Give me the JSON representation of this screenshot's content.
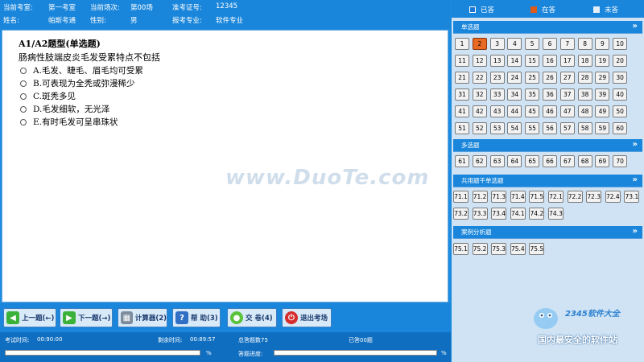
{
  "header": {
    "room_label": "当前考室:",
    "room_value": "第一考室",
    "session_label": "当前场次:",
    "session_value": "第00场",
    "ticket_label": "准考证号:",
    "ticket_value": "12345",
    "name_label": "姓名:",
    "name_value": "帕斯考通",
    "gender_label": "性别:",
    "gender_value": "男",
    "major_label": "报考专业:",
    "major_value": "软件专业"
  },
  "question": {
    "type_title": "A1/A2题型(单选题)",
    "stem": "肠病性肢端皮炎毛发受累特点不包括",
    "options": [
      "A.毛发、睫毛、眉毛均可受累",
      "B.可表现为全秃或弥漫稀少",
      "C.斑秃多见",
      "D.毛发细软，无光泽",
      "E.有时毛发可呈串珠状"
    ]
  },
  "toolbar": {
    "prev": "上一题(←)",
    "next": "下一题(→)",
    "calc": "计算器(2)",
    "help": "帮 助(3)",
    "submit": "交 卷(4)",
    "exit": "退出考场"
  },
  "footer": {
    "exam_time_label": "考试时间:",
    "exam_time_value": "00:90:00",
    "remaining_label": "剩余时间:",
    "remaining_value": "00:89:57",
    "total_label": "总答题数75",
    "answered_label": "已答00题",
    "progress_label": "答题进度:",
    "percent_sign": "%",
    "time_progress": 0,
    "answer_progress": 0
  },
  "legend": {
    "answered": "已答",
    "current": "在答",
    "unanswered": "未答"
  },
  "colors": {
    "answered": "#1e78d2",
    "current": "#e05a1a",
    "unanswered": "#e4eef8"
  },
  "sections": [
    {
      "title": "单选题",
      "current": "2",
      "items": [
        "1",
        "2",
        "3",
        "4",
        "5",
        "6",
        "7",
        "8",
        "9",
        "10",
        "11",
        "12",
        "13",
        "14",
        "15",
        "16",
        "17",
        "18",
        "19",
        "20",
        "21",
        "22",
        "23",
        "24",
        "25",
        "26",
        "27",
        "28",
        "29",
        "30",
        "31",
        "32",
        "33",
        "34",
        "35",
        "36",
        "37",
        "38",
        "39",
        "40",
        "41",
        "42",
        "43",
        "44",
        "45",
        "46",
        "47",
        "48",
        "49",
        "50",
        "51",
        "52",
        "53",
        "54",
        "55",
        "56",
        "57",
        "58",
        "59",
        "60"
      ]
    },
    {
      "title": "多选题",
      "items": [
        "61",
        "62",
        "63",
        "64",
        "65",
        "66",
        "67",
        "68",
        "69",
        "70"
      ]
    },
    {
      "title": "共用题干单选题",
      "items": [
        "71.1",
        "71.2",
        "71.3",
        "71.4",
        "71.5",
        "72.1",
        "72.2",
        "72.3",
        "72.4",
        "73.1",
        "73.2",
        "73.3",
        "73.4",
        "74.1",
        "74.2",
        "74.3"
      ]
    },
    {
      "title": "案例分析题",
      "items": [
        "75.1",
        "75.2",
        "75.3",
        "75.4",
        "75.5"
      ]
    }
  ],
  "watermarks": {
    "center": "www.DuoTe.com",
    "logo": "2345软件大全",
    "slogan": "国内最安全的软件站"
  }
}
